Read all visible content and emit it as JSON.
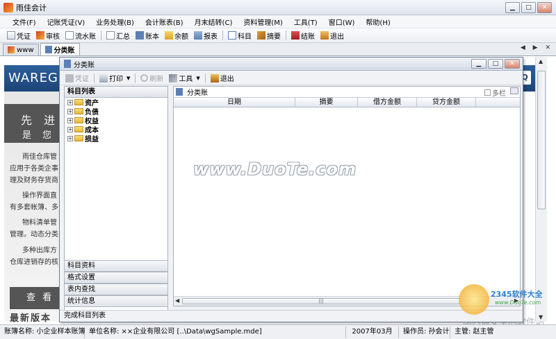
{
  "app": {
    "title": "雨佳会计"
  },
  "window_buttons": {
    "minimize": "▁",
    "maximize": "□",
    "close": "✕"
  },
  "menu": [
    "文件(F)",
    "记账凭证(V)",
    "业务处理(B)",
    "会计账表(B)",
    "月末结转(C)",
    "资料管理(M)",
    "工具(T)",
    "窗口(W)",
    "帮助(H)"
  ],
  "toolbar": [
    {
      "label": "凭证",
      "icon": "voucher-icon"
    },
    {
      "label": "审核",
      "icon": "audit-icon"
    },
    {
      "label": "流水账",
      "icon": "journal-icon"
    },
    {
      "label": "汇总",
      "icon": "summary-icon"
    },
    {
      "label": "账本",
      "icon": "ledger-icon"
    },
    {
      "label": "余额",
      "icon": "balance-icon"
    },
    {
      "label": "报表",
      "icon": "report-icon"
    },
    {
      "label": "科目",
      "icon": "account-icon"
    },
    {
      "label": "摘要",
      "icon": "abstract-icon"
    },
    {
      "label": "结账",
      "icon": "close-books-icon"
    },
    {
      "label": "退出",
      "icon": "exit-icon"
    }
  ],
  "tabs": [
    {
      "label": "www"
    },
    {
      "label": "分类账"
    }
  ],
  "tabnav": "◀ ▶ ✕",
  "background_page": {
    "logo": "WAREGO",
    "hero_line1": "先 进 的",
    "hero_line2": "是 您 和",
    "paragraphs": [
      "雨佳仓库管",
      "应用于各类企事",
      "理及财务存货商",
      "操作界面直",
      "有多套帐簿、多",
      "物料清单管",
      "管理。动态分类",
      "多种出库方",
      "仓库进销存的核"
    ],
    "view_button": "查 看 详",
    "latest": "最新版本",
    "watermark_text": "国内最安全的软件站"
  },
  "dialog": {
    "title": "分类账",
    "toolbar": [
      {
        "label": "凭证",
        "icon": "voucher-icon",
        "disabled": true
      },
      {
        "label": "打印",
        "icon": "print-icon",
        "dropdown": true
      },
      {
        "label": "刷新",
        "icon": "refresh-icon",
        "disabled": true
      },
      {
        "label": "工具",
        "icon": "tools-icon",
        "dropdown": true
      },
      {
        "label": "退出",
        "icon": "exit-icon"
      }
    ],
    "tree": {
      "header": "科目列表",
      "nodes": [
        "资产",
        "负债",
        "权益",
        "成本",
        "损益"
      ]
    },
    "accordion": [
      "科目资料",
      "格式设置",
      "表内查找",
      "统计信息"
    ],
    "grid": {
      "title": "分类账",
      "multi_col_label": "多栏",
      "columns": [
        "日期",
        "摘要",
        "借方金额",
        "贷方金额"
      ]
    },
    "status": "完成科目列表"
  },
  "overlay": {
    "duote": "www.DuoTe.com",
    "brand": "2345软件大全",
    "brand_url": "www.DuoTe.com"
  },
  "statusbar": [
    "账簿名称: 小企业样本账簿",
    "单位名称: ××企业有限公司 [..\\Data\\wgSample.mde]",
    "2007年03月",
    "操作员: 孙会计",
    "主管: 赵主管"
  ]
}
